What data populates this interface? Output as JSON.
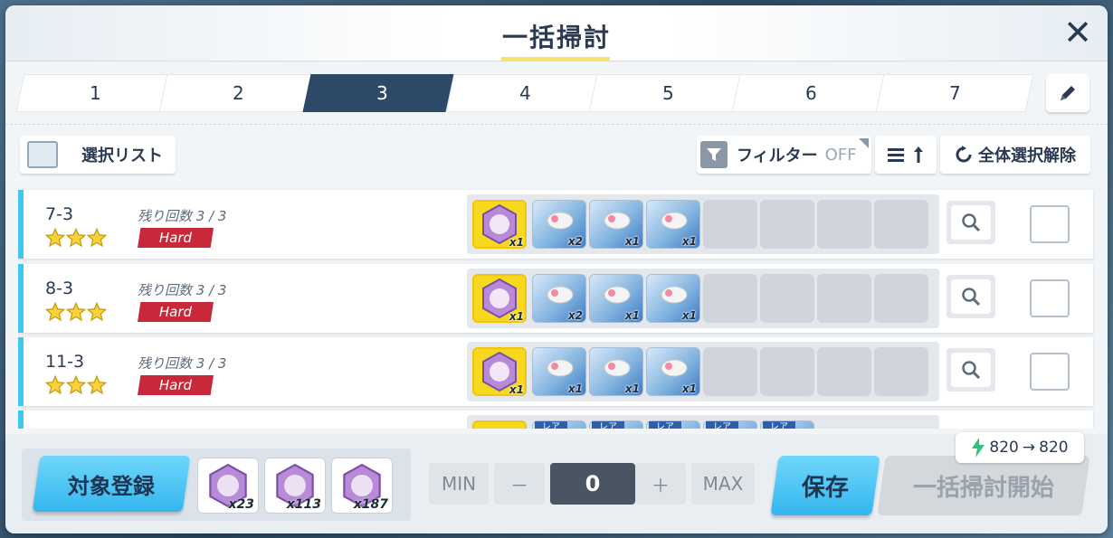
{
  "dialog": {
    "title": "一括掃討",
    "close_icon": "close-icon"
  },
  "tabs": [
    {
      "label": "1",
      "active": false
    },
    {
      "label": "2",
      "active": false
    },
    {
      "label": "3",
      "active": true
    },
    {
      "label": "4",
      "active": false
    },
    {
      "label": "5",
      "active": false
    },
    {
      "label": "6",
      "active": false
    },
    {
      "label": "7",
      "active": false
    }
  ],
  "toolbar": {
    "select_list_label": "選択リスト",
    "filter_label": "フィルター",
    "filter_state": "OFF",
    "deselect_all_label": "全体選択解除"
  },
  "stages": [
    {
      "name": "7-3",
      "stars": 3,
      "remaining": "残り回数 3 / 3",
      "difficulty": "Hard",
      "rewards": [
        {
          "kind": "char",
          "qty": "x1"
        },
        {
          "kind": "mat",
          "qty": "x2"
        },
        {
          "kind": "mat",
          "qty": "x1"
        },
        {
          "kind": "mat",
          "qty": "x1"
        }
      ]
    },
    {
      "name": "8-3",
      "stars": 3,
      "remaining": "残り回数 3 / 3",
      "difficulty": "Hard",
      "rewards": [
        {
          "kind": "char",
          "qty": "x1"
        },
        {
          "kind": "mat",
          "qty": "x2"
        },
        {
          "kind": "mat",
          "qty": "x1"
        },
        {
          "kind": "mat",
          "qty": "x1"
        }
      ]
    },
    {
      "name": "11-3",
      "stars": 3,
      "remaining": "残り回数 3 / 3",
      "difficulty": "Hard",
      "rewards": [
        {
          "kind": "char",
          "qty": "x1"
        },
        {
          "kind": "mat",
          "qty": "x1"
        },
        {
          "kind": "mat",
          "qty": "x1"
        },
        {
          "kind": "mat",
          "qty": "x1"
        }
      ]
    }
  ],
  "partial_row": {
    "rare_label": "レア"
  },
  "bottom": {
    "register_label": "対象登録",
    "stones": [
      {
        "qty": "x23"
      },
      {
        "qty": "x113"
      },
      {
        "qty": "x187"
      }
    ],
    "min_label": "MIN",
    "max_label": "MAX",
    "minus_label": "－",
    "plus_label": "＋",
    "count": "0",
    "save_label": "保存",
    "start_label": "一括掃討開始",
    "ap_from": "820",
    "ap_arrow": "→",
    "ap_to": "820"
  },
  "colors": {
    "accent": "#34b6ee",
    "active_tab": "#2c4968",
    "hard": "#c8293a",
    "row_accent": "#3ec8f0"
  }
}
